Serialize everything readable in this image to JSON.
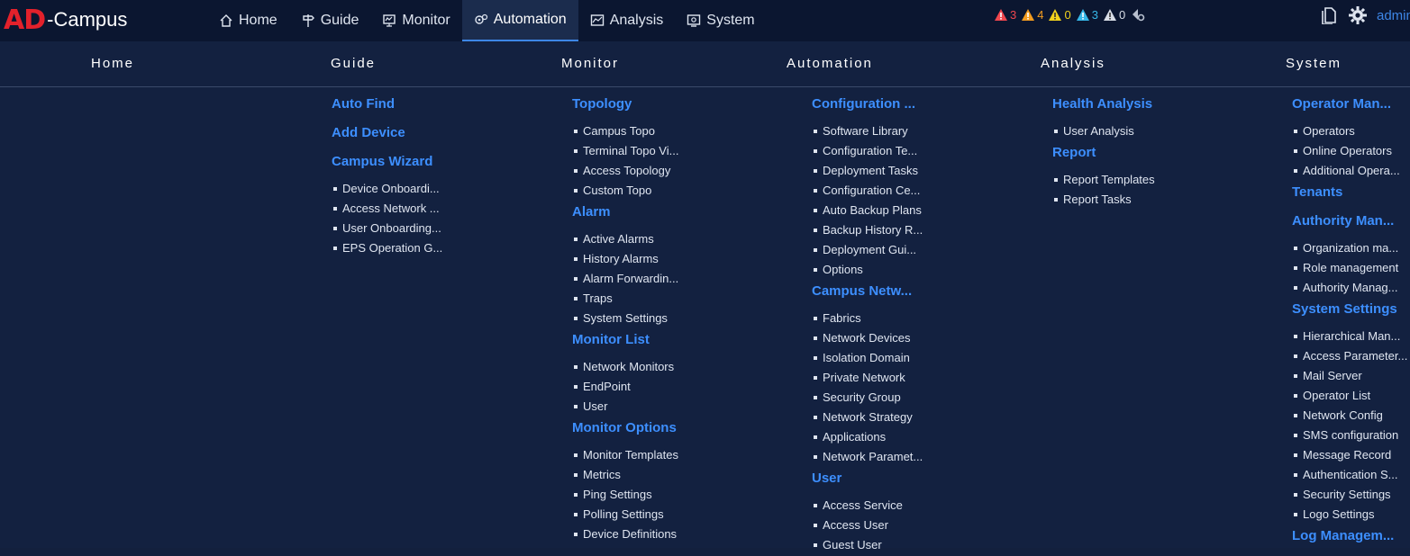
{
  "brand": {
    "logo_ad": "AD",
    "logo_rest": "-Campus"
  },
  "nav": [
    {
      "label": "Home",
      "icon": "home-icon"
    },
    {
      "label": "Guide",
      "icon": "signpost-icon"
    },
    {
      "label": "Monitor",
      "icon": "monitor-icon"
    },
    {
      "label": "Automation",
      "icon": "gears-icon",
      "active": true
    },
    {
      "label": "Analysis",
      "icon": "chart-icon"
    },
    {
      "label": "System",
      "icon": "system-icon"
    }
  ],
  "alarms": [
    {
      "count": "3",
      "color": "#f0474e"
    },
    {
      "count": "4",
      "color": "#f39c1f"
    },
    {
      "count": "0",
      "color": "#f1d21c"
    },
    {
      "count": "3",
      "color": "#36b7e8"
    },
    {
      "count": "0",
      "color": "#d8dde6"
    }
  ],
  "user": {
    "name": "admin"
  },
  "columns": [
    "Home",
    "Guide",
    "Monitor",
    "Automation",
    "Analysis",
    "System"
  ],
  "menu": {
    "guide": [
      {
        "title": "Auto Find",
        "items": []
      },
      {
        "title": "Add Device",
        "items": []
      },
      {
        "title": "Campus Wizard",
        "items": [
          "Device Onboardi...",
          "Access Network ...",
          "User Onboarding...",
          "EPS Operation G..."
        ]
      }
    ],
    "monitor": [
      {
        "title": "Topology",
        "items": [
          "Campus Topo",
          "Terminal Topo Vi...",
          "Access Topology",
          "Custom Topo"
        ]
      },
      {
        "title": "Alarm",
        "items": [
          "Active Alarms",
          "History Alarms",
          "Alarm Forwardin...",
          "Traps",
          "System Settings"
        ]
      },
      {
        "title": "Monitor List",
        "items": [
          "Network Monitors",
          "EndPoint",
          "User"
        ]
      },
      {
        "title": "Monitor Options",
        "items": [
          "Monitor Templates",
          "Metrics",
          "Ping Settings",
          "Polling Settings",
          "Device Definitions"
        ]
      }
    ],
    "automation": [
      {
        "title": "Configuration ...",
        "items": [
          "Software Library",
          "Configuration Te...",
          "Deployment Tasks",
          "Configuration Ce...",
          "Auto Backup Plans",
          "Backup History R...",
          "Deployment Gui...",
          "Options"
        ]
      },
      {
        "title": "Campus Netw...",
        "items": [
          "Fabrics",
          "Network Devices",
          "Isolation Domain",
          "Private Network",
          "Security Group",
          "Network Strategy",
          "Applications",
          "Network Paramet..."
        ]
      },
      {
        "title": "User",
        "items": [
          "Access Service",
          "Access User",
          "Guest User"
        ]
      }
    ],
    "analysis": [
      {
        "title": "Health Analysis",
        "items": [
          "User Analysis"
        ]
      },
      {
        "title": "Report",
        "items": [
          "Report Templates",
          "Report Tasks"
        ]
      }
    ],
    "system": [
      {
        "title": "Operator Man...",
        "items": [
          "Operators",
          "Online Operators",
          "Additional Opera..."
        ]
      },
      {
        "title": "Tenants",
        "items": []
      },
      {
        "title": "Authority Man...",
        "items": [
          "Organization ma...",
          "Role management",
          "Authority Manag..."
        ]
      },
      {
        "title": "System Settings",
        "items": [
          "Hierarchical Man...",
          "Access Parameter...",
          "Mail Server",
          "Operator List",
          "Network Config",
          "SMS configuration",
          "Message Record",
          "Authentication S...",
          "Security Settings",
          "Logo Settings"
        ]
      },
      {
        "title": "Log Managem...",
        "items": []
      }
    ]
  }
}
